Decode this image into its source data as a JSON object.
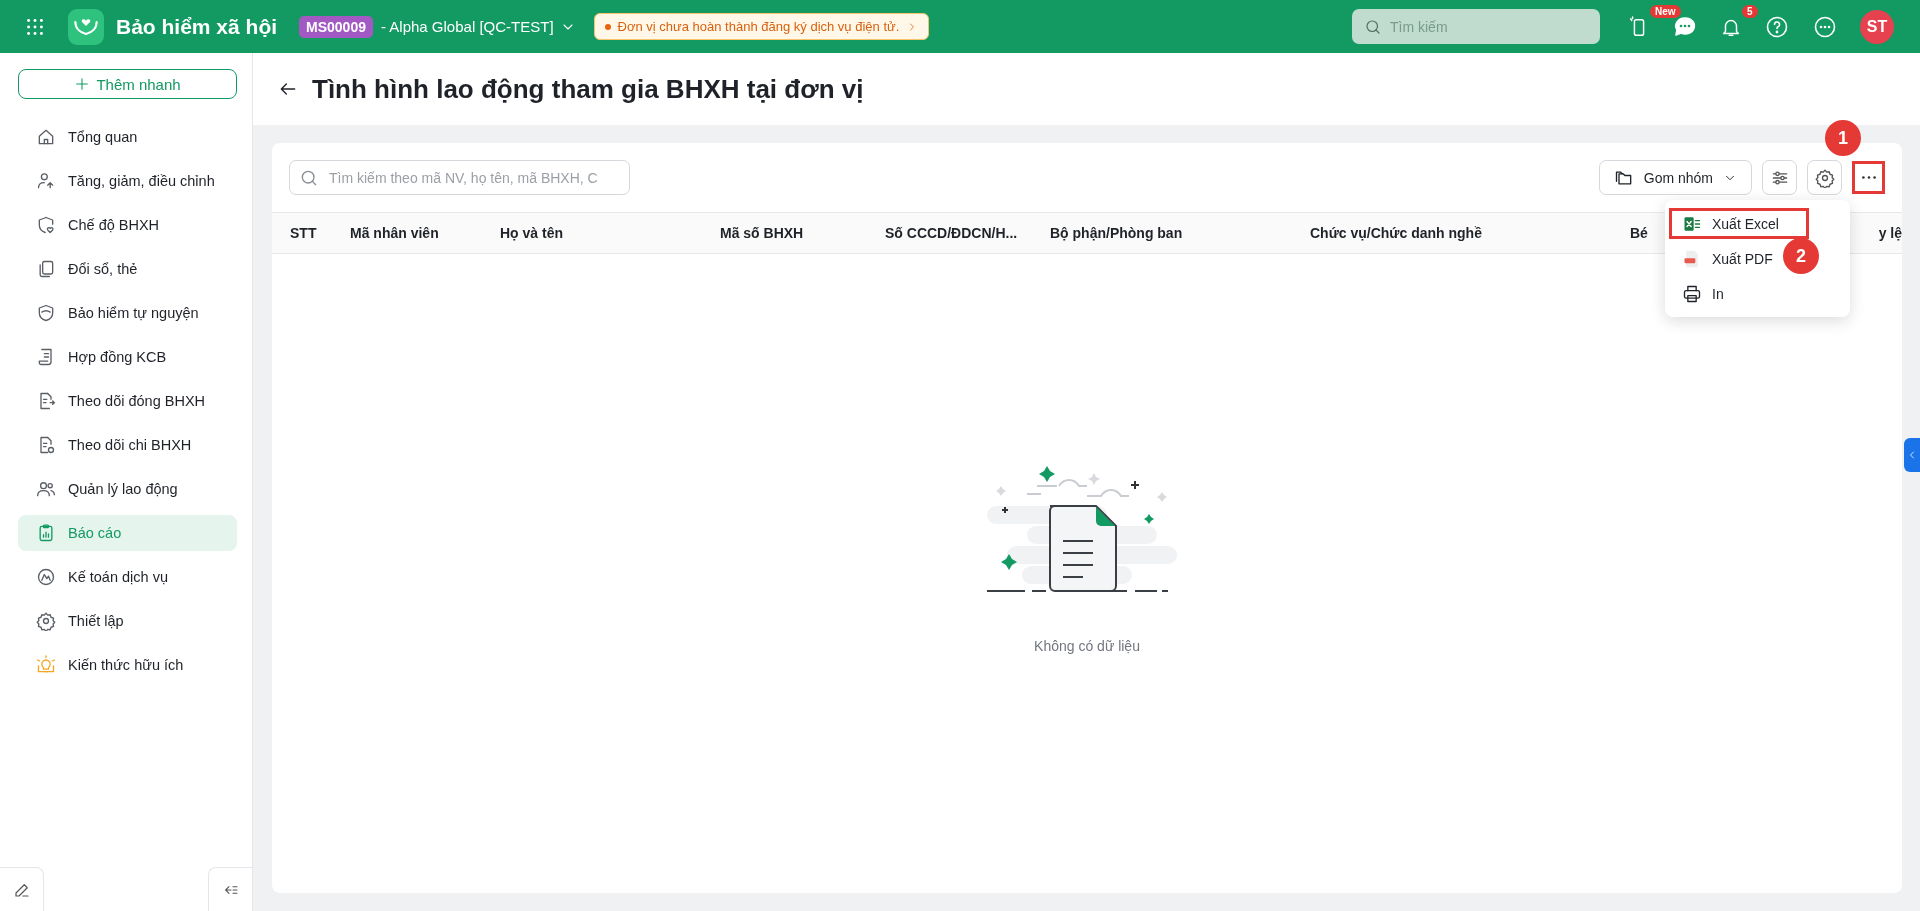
{
  "topbar": {
    "app_title": "Bảo hiểm xã hội",
    "org_code": "MS00009",
    "org_name": "- Alpha Global [QC-TEST]",
    "notice": "Đơn vị chưa hoàn thành đăng ký dịch vụ điện tử.",
    "search": {
      "placeholder": "Tìm kiếm"
    },
    "new_badge": "New",
    "notification_count": "5",
    "avatar": "ST"
  },
  "sidebar": {
    "quick_add": "Thêm nhanh",
    "items": [
      {
        "label": "Tổng quan",
        "selected": false
      },
      {
        "label": "Tăng, giảm, điều chỉnh",
        "selected": false
      },
      {
        "label": "Chế độ BHXH",
        "selected": false
      },
      {
        "label": "Đổi sổ, thẻ",
        "selected": false
      },
      {
        "label": "Bảo hiểm tự nguyện",
        "selected": false
      },
      {
        "label": "Hợp đồng KCB",
        "selected": false
      },
      {
        "label": "Theo dõi đóng BHXH",
        "selected": false
      },
      {
        "label": "Theo dõi chi BHXH",
        "selected": false
      },
      {
        "label": "Quản lý lao động",
        "selected": false
      },
      {
        "label": "Báo cáo",
        "selected": true
      },
      {
        "label": "Kế toán dịch vụ",
        "selected": false
      },
      {
        "label": "Thiết lập",
        "selected": false
      },
      {
        "label": "Kiến thức hữu ích",
        "selected": false
      }
    ]
  },
  "page": {
    "title": "Tình hình lao động tham gia BHXH tại đơn vị"
  },
  "toolbar": {
    "search": {
      "placeholder": "Tìm kiếm theo mã NV, họ tên, mã BHXH, C"
    },
    "group_button": "Gom nhóm",
    "more_highlighted": true
  },
  "table": {
    "columns": [
      "STT",
      "Mã nhân viên",
      "Họ và tên",
      "Mã số BHXH",
      "Số CCCD/ĐDCN/H...",
      "Bộ phận/Phòng ban",
      "Chức vụ/Chức danh nghề",
      "Bé",
      "y lệ"
    ],
    "empty_text": "Không có dữ liệu"
  },
  "more_menu": {
    "items": [
      {
        "label": "Xuất Excel",
        "kind": "excel",
        "highlighted": true
      },
      {
        "label": "Xuất PDF",
        "kind": "pdf",
        "highlighted": false
      },
      {
        "label": "In",
        "kind": "print",
        "highlighted": false
      }
    ]
  },
  "annotations": [
    {
      "label": "1"
    },
    {
      "label": "2"
    }
  ]
}
